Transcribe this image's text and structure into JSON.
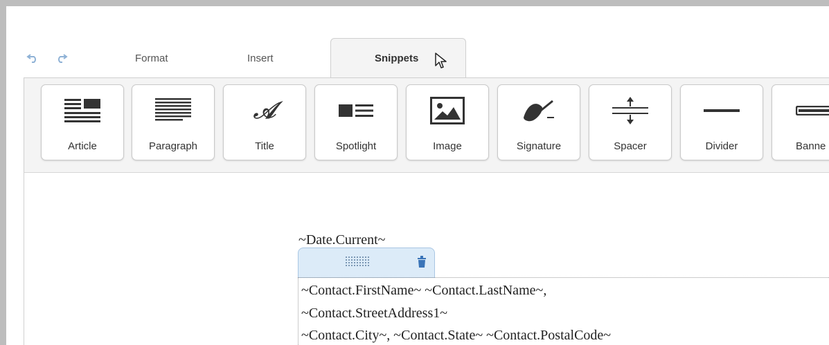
{
  "tabs": {
    "format": "Format",
    "insert": "Insert",
    "snippets": "Snippets"
  },
  "toolbar": {
    "undo_icon": "undo-icon",
    "redo_icon": "redo-icon",
    "snippets": [
      {
        "label": "Article",
        "icon": "article-icon"
      },
      {
        "label": "Paragraph",
        "icon": "paragraph-icon"
      },
      {
        "label": "Title",
        "icon": "title-icon"
      },
      {
        "label": "Spotlight",
        "icon": "spotlight-icon"
      },
      {
        "label": "Image",
        "icon": "image-icon"
      },
      {
        "label": "Signature",
        "icon": "signature-icon"
      },
      {
        "label": "Spacer",
        "icon": "spacer-icon"
      },
      {
        "label": "Divider",
        "icon": "divider-icon"
      },
      {
        "label": "Banne",
        "icon": "banner-icon"
      }
    ]
  },
  "content": {
    "date_line": "~Date.Current~",
    "lines": [
      "~Contact.FirstName~ ~Contact.LastName~,",
      "~Contact.StreetAddress1~",
      "~Contact.City~, ~Contact.State~ ~Contact.PostalCode~"
    ]
  },
  "colors": {
    "accent": "#8fb2d6",
    "block_handle": "#dcebf8"
  }
}
